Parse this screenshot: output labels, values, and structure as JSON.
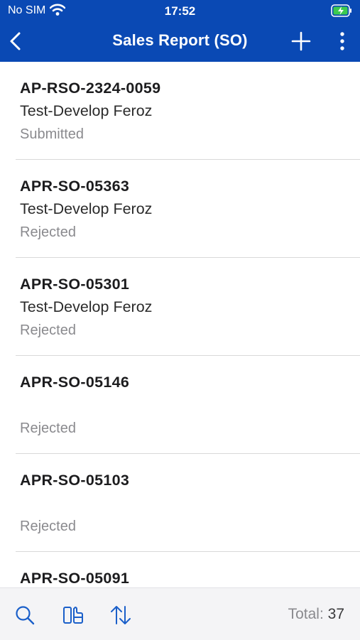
{
  "status_bar": {
    "carrier": "No SIM",
    "time": "17:52",
    "icons": [
      "wifi-icon",
      "battery-charging-icon"
    ]
  },
  "nav": {
    "title": "Sales Report (SO)",
    "back_icon": "chevron-left-icon",
    "add_icon": "plus-icon",
    "more_icon": "more-vertical-icon"
  },
  "items": [
    {
      "id": "AP-RSO-2324-0059",
      "owner": "Test-Develop Feroz",
      "status": "Submitted"
    },
    {
      "id": "APR-SO-05363",
      "owner": "Test-Develop Feroz",
      "status": "Rejected"
    },
    {
      "id": "APR-SO-05301",
      "owner": "Test-Develop Feroz",
      "status": "Rejected"
    },
    {
      "id": "APR-SO-05146",
      "owner": "",
      "status": "Rejected"
    },
    {
      "id": "APR-SO-05103",
      "owner": "",
      "status": "Rejected"
    },
    {
      "id": "APR-SO-05091",
      "owner": "",
      "status": ""
    }
  ],
  "toolbar": {
    "search_icon": "search-icon",
    "layout_icon": "layout-icon",
    "sort_icon": "sort-icon",
    "total_label": "Total:",
    "total_value": "37"
  },
  "colors": {
    "brand": "#0a49b4",
    "accent": "#1a5fc9",
    "secondary_text": "#8a8a8e",
    "toolbar_bg": "#f4f4f6"
  }
}
